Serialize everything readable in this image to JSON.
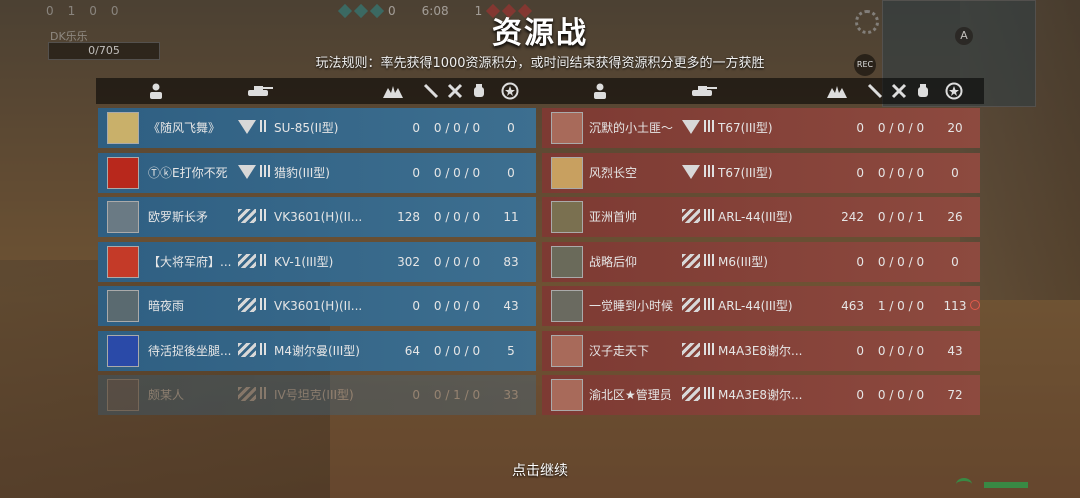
{
  "hud": {
    "stats": [
      "0",
      "1",
      "0",
      "0"
    ],
    "player_tag": "DK乐乐",
    "progress_text": "0/705",
    "timer": "6:08",
    "left_team_score": "0",
    "right_team_score": "1",
    "minimap_marker": "A",
    "rec_label": "REC"
  },
  "title": "资源战",
  "rules": "玩法规则：率先获得1000资源积分，或时间结束获得资源积分更多的一方获胜",
  "header_icons": [
    "rank-icon",
    "tank-icon",
    "score-icon",
    "kill-icon",
    "assist-icon",
    "death-icon",
    "resource-icon"
  ],
  "colors": {
    "blue_team": "#2f5f82",
    "red_team": "#7d3a33",
    "header": "#000000"
  },
  "blue_team": [
    {
      "name": "《随风飞舞》",
      "rank_type": "chevron",
      "rank_bars": 2,
      "tank": "SU-85(II型)",
      "score": "0",
      "kda": "0 / 0 / 0",
      "resource": "0",
      "avatar_color": "#c9b06a"
    },
    {
      "name": "ⓉⓚE打你不死",
      "rank_type": "chevron",
      "rank_bars": 3,
      "tank": "猎豹(III型)",
      "score": "0",
      "kda": "0 / 0 / 0",
      "resource": "0",
      "avatar_color": "#b8281c"
    },
    {
      "name": "欧罗斯长矛",
      "rank_type": "stripes",
      "rank_bars": 2,
      "tank": "VK3601(H)(II...",
      "score": "128",
      "kda": "0 / 0 / 0",
      "resource": "11",
      "avatar_color": "#6a7a84"
    },
    {
      "name": "【大将军府】...",
      "rank_type": "stripes",
      "rank_bars": 2,
      "tank": "KV-1(III型)",
      "score": "302",
      "kda": "0 / 0 / 0",
      "resource": "83",
      "avatar_color": "#c43a28"
    },
    {
      "name": "暗夜雨",
      "rank_type": "stripes",
      "rank_bars": 2,
      "tank": "VK3601(H)(II...",
      "score": "0",
      "kda": "0 / 0 / 0",
      "resource": "43",
      "avatar_color": "#5a6a70"
    },
    {
      "name": "待活捉後坐腿...",
      "rank_type": "stripes",
      "rank_bars": 2,
      "tank": "M4谢尔曼(III型)",
      "score": "64",
      "kda": "0 / 0 / 0",
      "resource": "5",
      "avatar_color": "#2a4aa8"
    },
    {
      "name": "颇某人",
      "rank_type": "stripes",
      "rank_bars": 2,
      "tank": "IV号坦克(III型)",
      "score": "0",
      "kda": "0 / 1 / 0",
      "resource": "33",
      "avatar_color": "#556070",
      "faded": true
    }
  ],
  "red_team": [
    {
      "name": "沉默的小土匪～",
      "rank_type": "chevron",
      "rank_bars": 3,
      "tank": "T67(III型)",
      "score": "0",
      "kda": "0 / 0 / 0",
      "resource": "20",
      "avatar_color": "#a86a5a"
    },
    {
      "name": "风烈长空",
      "rank_type": "chevron",
      "rank_bars": 3,
      "tank": "T67(III型)",
      "score": "0",
      "kda": "0 / 0 / 0",
      "resource": "0",
      "avatar_color": "#c8a060"
    },
    {
      "name": "亚洲首帅",
      "rank_type": "stripes",
      "rank_bars": 3,
      "tank": "ARL-44(III型)",
      "score": "242",
      "kda": "0 / 0 / 1",
      "resource": "26",
      "avatar_color": "#7a7050"
    },
    {
      "name": "战略后仰",
      "rank_type": "stripes",
      "rank_bars": 3,
      "tank": "M6(III型)",
      "score": "0",
      "kda": "0 / 0 / 0",
      "resource": "0",
      "avatar_color": "#6a6a5a"
    },
    {
      "name": "一觉睡到小时候",
      "rank_type": "stripes",
      "rank_bars": 3,
      "tank": "ARL-44(III型)",
      "score": "463",
      "kda": "1 / 0 / 0",
      "resource": "113",
      "avatar_color": "#6a6a60",
      "target": true
    },
    {
      "name": "汉子走天下",
      "rank_type": "stripes",
      "rank_bars": 3,
      "tank": "M4A3E8谢尔...",
      "score": "0",
      "kda": "0 / 0 / 0",
      "resource": "43",
      "avatar_color": "#a86a5a"
    },
    {
      "name": "渝北区★管理员",
      "rank_type": "stripes",
      "rank_bars": 3,
      "tank": "M4A3E8谢尔...",
      "score": "0",
      "kda": "0 / 0 / 0",
      "resource": "72",
      "avatar_color": "#a86a5a"
    }
  ],
  "continue_label": "点击继续"
}
